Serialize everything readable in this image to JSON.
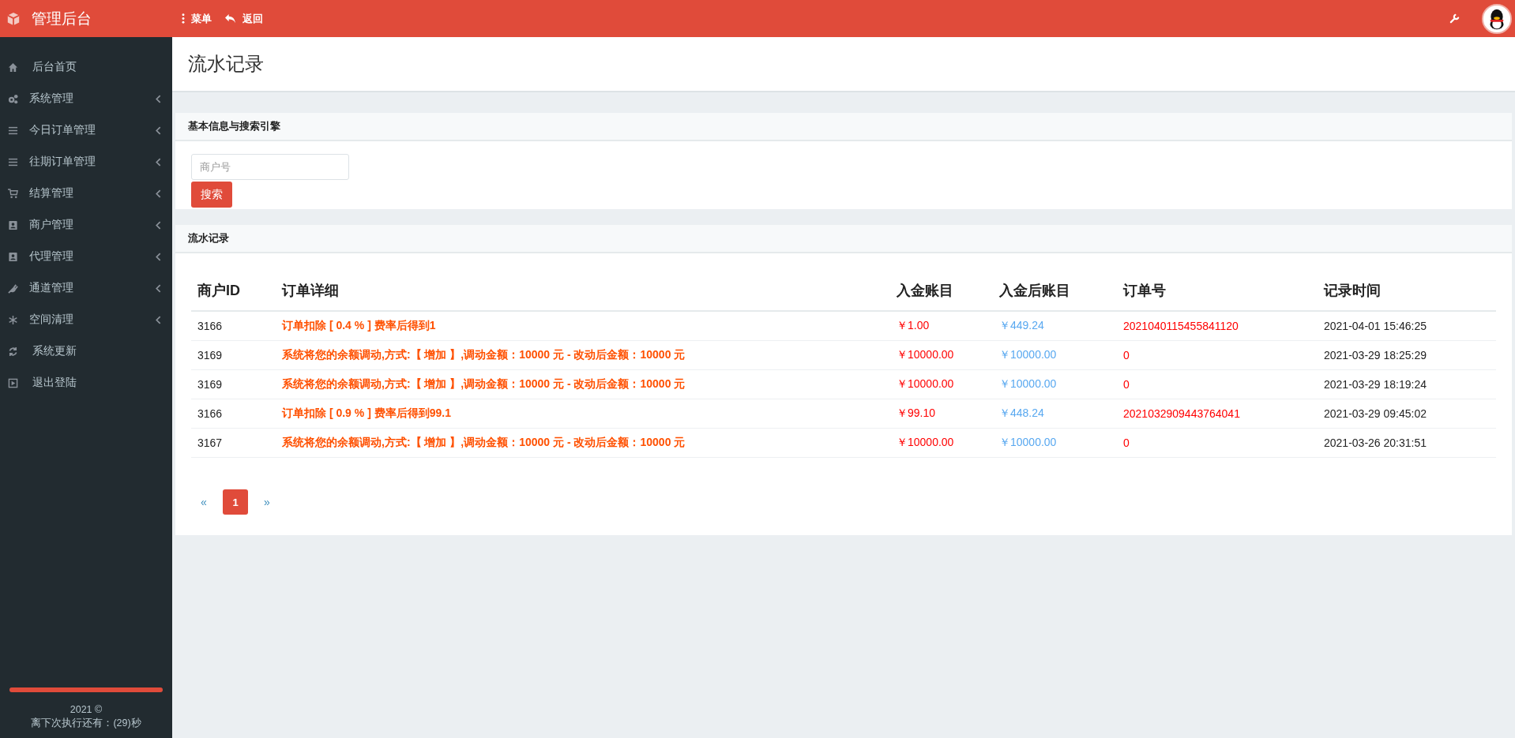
{
  "header": {
    "brand": "管理后台",
    "nav": [
      {
        "kind": "menu",
        "label": "菜单"
      },
      {
        "kind": "back",
        "label": "返回"
      }
    ]
  },
  "sidebar": {
    "items": [
      {
        "kind": "home",
        "label": "后台首页",
        "has_submenu": false
      },
      {
        "kind": "system",
        "label": "系统管理",
        "has_submenu": true
      },
      {
        "kind": "orders",
        "label": "今日订单管理",
        "has_submenu": true
      },
      {
        "kind": "orders",
        "label": "往期订单管理",
        "has_submenu": true
      },
      {
        "kind": "settlement",
        "label": "结算管理",
        "has_submenu": true
      },
      {
        "kind": "merchant",
        "label": "商户管理",
        "has_submenu": true
      },
      {
        "kind": "merchant",
        "label": "代理管理",
        "has_submenu": true
      },
      {
        "kind": "channel",
        "label": "通道管理",
        "has_submenu": true
      },
      {
        "kind": "cleanup",
        "label": "空间清理",
        "has_submenu": true
      },
      {
        "kind": "update",
        "label": "系统更新",
        "has_submenu": false
      },
      {
        "kind": "logout",
        "label": "退出登陆",
        "has_submenu": false
      }
    ],
    "countdown": {
      "level": 1
    },
    "copyright": "2021 ©",
    "countdown_text": "离下次执行还有：(29)秒"
  },
  "page_title": "流水记录",
  "search_panel": {
    "title": "基本信息与搜索引擎",
    "field": {
      "placeholder": "商户号"
    },
    "button": "搜索"
  },
  "records_panel": {
    "title": "流水记录",
    "table": {
      "columns": [
        "商户ID",
        "订单详细",
        "入金账目",
        "入金后账目",
        "订单号",
        "记录时间"
      ],
      "rows": [
        [
          "3166",
          "订单扣除 [ 0.4 % ] 费率后得到1",
          "￥1.00",
          "￥449.24",
          "2021040115455841120",
          "2021-04-01 15:46:25"
        ],
        [
          "3169",
          "系统将您的余额调动,方式:【 增加 】,调动金额：10000 元 - 改动后金额：10000 元",
          "￥10000.00",
          "￥10000.00",
          "0",
          "2021-03-29 18:25:29"
        ],
        [
          "3169",
          "系统将您的余额调动,方式:【 增加 】,调动金额：10000 元 - 改动后金额：10000 元",
          "￥10000.00",
          "￥10000.00",
          "0",
          "2021-03-29 18:19:24"
        ],
        [
          "3166",
          "订单扣除 [ 0.9 % ] 费率后得到99.1",
          "￥99.10",
          "￥448.24",
          "2021032909443764041",
          "2021-03-29 09:45:02"
        ],
        [
          "3167",
          "系统将您的余额调动,方式:【 增加 】,调动金额：10000 元 - 改动后金额：10000 元",
          "￥10000.00",
          "￥10000.00",
          "0",
          "2021-03-26 20:31:51"
        ]
      ]
    },
    "pagination": [
      {
        "label": "«",
        "kind": "prev",
        "selected": false
      },
      {
        "label": "1",
        "kind": "page",
        "selected": true
      },
      {
        "label": "»",
        "kind": "next",
        "selected": false
      }
    ]
  }
}
